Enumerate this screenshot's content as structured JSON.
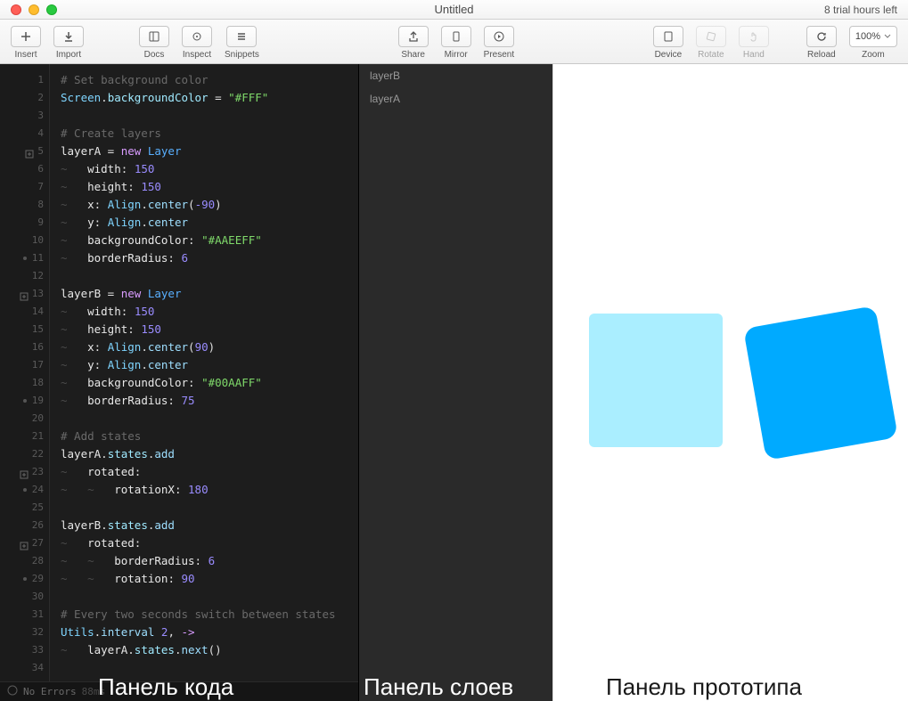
{
  "window": {
    "title": "Untitled",
    "trial": "8 trial hours left"
  },
  "toolbar": {
    "insert": "Insert",
    "import": "Import",
    "docs": "Docs",
    "inspect": "Inspect",
    "snippets": "Snippets",
    "share": "Share",
    "mirror": "Mirror",
    "present": "Present",
    "device": "Device",
    "rotate": "Rotate",
    "hand": "Hand",
    "reload": "Reload",
    "zoom": "Zoom",
    "zoom_value": "100%"
  },
  "layers": {
    "items": [
      "layerB",
      "layerA"
    ]
  },
  "code": {
    "lines": [
      {
        "n": 1,
        "t": "comment",
        "text": "# Set background color"
      },
      {
        "n": 2,
        "t": "code",
        "segs": [
          [
            "class",
            "Screen"
          ],
          [
            "op",
            "."
          ],
          [
            "prop",
            "backgroundColor"
          ],
          [
            "op",
            " = "
          ],
          [
            "str",
            "\"#FFF\""
          ]
        ]
      },
      {
        "n": 3,
        "t": "blank"
      },
      {
        "n": 4,
        "t": "comment",
        "text": "# Create layers"
      },
      {
        "n": 5,
        "fold": true,
        "t": "code",
        "segs": [
          [
            "ident",
            "layerA"
          ],
          [
            "op",
            " = "
          ],
          [
            "kw",
            "new "
          ],
          [
            "type",
            "Layer"
          ]
        ]
      },
      {
        "n": 6,
        "indent": "~   ",
        "t": "code",
        "segs": [
          [
            "ident",
            "width"
          ],
          [
            "op",
            ": "
          ],
          [
            "num",
            "150"
          ]
        ]
      },
      {
        "n": 7,
        "indent": "~   ",
        "t": "code",
        "segs": [
          [
            "ident",
            "height"
          ],
          [
            "op",
            ": "
          ],
          [
            "num",
            "150"
          ]
        ]
      },
      {
        "n": 8,
        "indent": "~   ",
        "t": "code",
        "segs": [
          [
            "ident",
            "x"
          ],
          [
            "op",
            ": "
          ],
          [
            "class",
            "Align"
          ],
          [
            "op",
            "."
          ],
          [
            "method",
            "center"
          ],
          [
            "op",
            "("
          ],
          [
            "num",
            "-90"
          ],
          [
            "op",
            ")"
          ]
        ]
      },
      {
        "n": 9,
        "indent": "~   ",
        "t": "code",
        "segs": [
          [
            "ident",
            "y"
          ],
          [
            "op",
            ": "
          ],
          [
            "class",
            "Align"
          ],
          [
            "op",
            "."
          ],
          [
            "method",
            "center"
          ]
        ]
      },
      {
        "n": 10,
        "indent": "~   ",
        "t": "code",
        "segs": [
          [
            "ident",
            "backgroundColor"
          ],
          [
            "op",
            ": "
          ],
          [
            "str",
            "\"#AAEEFF\""
          ]
        ]
      },
      {
        "n": 11,
        "dot": true,
        "indent": "~   ",
        "t": "code",
        "segs": [
          [
            "ident",
            "borderRadius"
          ],
          [
            "op",
            ": "
          ],
          [
            "num",
            "6"
          ]
        ]
      },
      {
        "n": 12,
        "t": "blank"
      },
      {
        "n": 13,
        "fold": true,
        "t": "code",
        "segs": [
          [
            "ident",
            "layerB"
          ],
          [
            "op",
            " = "
          ],
          [
            "kw",
            "new "
          ],
          [
            "type",
            "Layer"
          ]
        ]
      },
      {
        "n": 14,
        "indent": "~   ",
        "t": "code",
        "segs": [
          [
            "ident",
            "width"
          ],
          [
            "op",
            ": "
          ],
          [
            "num",
            "150"
          ]
        ]
      },
      {
        "n": 15,
        "indent": "~   ",
        "t": "code",
        "segs": [
          [
            "ident",
            "height"
          ],
          [
            "op",
            ": "
          ],
          [
            "num",
            "150"
          ]
        ]
      },
      {
        "n": 16,
        "indent": "~   ",
        "t": "code",
        "segs": [
          [
            "ident",
            "x"
          ],
          [
            "op",
            ": "
          ],
          [
            "class",
            "Align"
          ],
          [
            "op",
            "."
          ],
          [
            "method",
            "center"
          ],
          [
            "op",
            "("
          ],
          [
            "num",
            "90"
          ],
          [
            "op",
            ")"
          ]
        ]
      },
      {
        "n": 17,
        "indent": "~   ",
        "t": "code",
        "segs": [
          [
            "ident",
            "y"
          ],
          [
            "op",
            ": "
          ],
          [
            "class",
            "Align"
          ],
          [
            "op",
            "."
          ],
          [
            "method",
            "center"
          ]
        ]
      },
      {
        "n": 18,
        "indent": "~   ",
        "t": "code",
        "segs": [
          [
            "ident",
            "backgroundColor"
          ],
          [
            "op",
            ": "
          ],
          [
            "str",
            "\"#00AAFF\""
          ]
        ]
      },
      {
        "n": 19,
        "dot": true,
        "indent": "~   ",
        "t": "code",
        "segs": [
          [
            "ident",
            "borderRadius"
          ],
          [
            "op",
            ": "
          ],
          [
            "num",
            "75"
          ]
        ]
      },
      {
        "n": 20,
        "t": "blank"
      },
      {
        "n": 21,
        "t": "comment",
        "text": "# Add states"
      },
      {
        "n": 22,
        "t": "code",
        "segs": [
          [
            "ident",
            "layerA"
          ],
          [
            "op",
            "."
          ],
          [
            "prop",
            "states"
          ],
          [
            "op",
            "."
          ],
          [
            "method",
            "add"
          ]
        ]
      },
      {
        "n": 23,
        "fold": true,
        "indent": "~   ",
        "t": "code",
        "segs": [
          [
            "ident",
            "rotated"
          ],
          [
            "op",
            ":"
          ]
        ]
      },
      {
        "n": 24,
        "dot": true,
        "indent": "~   ~   ",
        "t": "code",
        "segs": [
          [
            "ident",
            "rotationX"
          ],
          [
            "op",
            ": "
          ],
          [
            "num",
            "180"
          ]
        ]
      },
      {
        "n": 25,
        "t": "blank"
      },
      {
        "n": 26,
        "t": "code",
        "segs": [
          [
            "ident",
            "layerB"
          ],
          [
            "op",
            "."
          ],
          [
            "prop",
            "states"
          ],
          [
            "op",
            "."
          ],
          [
            "method",
            "add"
          ]
        ]
      },
      {
        "n": 27,
        "fold": true,
        "indent": "~   ",
        "t": "code",
        "segs": [
          [
            "ident",
            "rotated"
          ],
          [
            "op",
            ":"
          ]
        ]
      },
      {
        "n": 28,
        "indent": "~   ~   ",
        "t": "code",
        "segs": [
          [
            "ident",
            "borderRadius"
          ],
          [
            "op",
            ": "
          ],
          [
            "num",
            "6"
          ]
        ]
      },
      {
        "n": 29,
        "dot": true,
        "indent": "~   ~   ",
        "t": "code",
        "segs": [
          [
            "ident",
            "rotation"
          ],
          [
            "op",
            ": "
          ],
          [
            "num",
            "90"
          ]
        ]
      },
      {
        "n": 30,
        "t": "blank"
      },
      {
        "n": 31,
        "t": "comment",
        "text": "# Every two seconds switch between states"
      },
      {
        "n": 32,
        "t": "code",
        "segs": [
          [
            "class",
            "Utils"
          ],
          [
            "op",
            "."
          ],
          [
            "method",
            "interval"
          ],
          [
            "op",
            " "
          ],
          [
            "num",
            "2"
          ],
          [
            "op",
            ", "
          ],
          [
            "kw",
            "->"
          ]
        ]
      },
      {
        "n": 33,
        "indent": "~   ",
        "t": "code",
        "segs": [
          [
            "ident",
            "layerA"
          ],
          [
            "op",
            "."
          ],
          [
            "prop",
            "states"
          ],
          [
            "op",
            "."
          ],
          [
            "method",
            "next"
          ],
          [
            "op",
            "()"
          ]
        ]
      },
      {
        "n": 34,
        "t": "blank"
      }
    ]
  },
  "status": {
    "errors": "No Errors",
    "ms": "88ms"
  },
  "overlays": {
    "code": "Панель кода",
    "layers": "Панель слоев",
    "preview": "Панель прототипа"
  }
}
